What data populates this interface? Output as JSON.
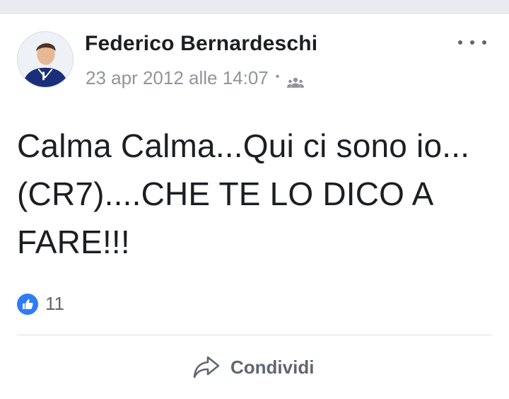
{
  "post": {
    "author": "Federico Bernardeschi",
    "timestamp": "23 apr 2012 alle 14:07",
    "separator": "•",
    "privacy_icon": "friends-icon",
    "text": "Calma Calma...Qui ci sono io...(CR7)....CHE TE LO DICO A FARE!!!"
  },
  "reactions": {
    "icon": "like-icon",
    "count": "11"
  },
  "actions": {
    "share_label": "Condividi",
    "share_icon": "share-arrow-icon"
  },
  "colors": {
    "author_text": "#1c1e21",
    "meta_text": "#90949c",
    "like_blue": "#2e7cf6",
    "action_gray": "#606770",
    "top_bar": "#e9ebee"
  }
}
